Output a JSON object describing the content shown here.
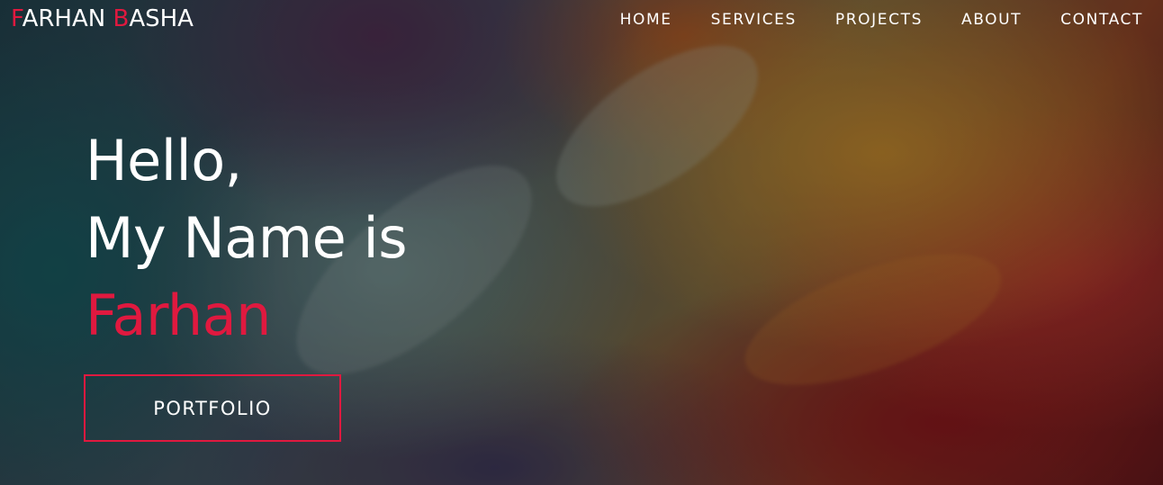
{
  "logo": {
    "first_initial": "F",
    "first_rest": "ARHAN ",
    "last_initial": "B",
    "last_rest": "ASHA"
  },
  "nav": {
    "items": [
      {
        "label": "HOME"
      },
      {
        "label": "SERVICES"
      },
      {
        "label": "PROJECTS"
      },
      {
        "label": "ABOUT"
      },
      {
        "label": "CONTACT"
      }
    ]
  },
  "hero": {
    "greeting": "Hello,",
    "intro": "My Name is",
    "name": "Farhan",
    "button_label": "PORTFOLIO"
  },
  "colors": {
    "accent": "#e0193f",
    "text": "#ffffff"
  }
}
